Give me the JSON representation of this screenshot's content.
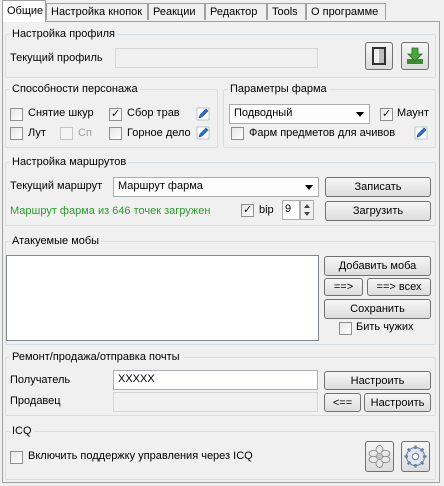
{
  "tabs": [
    "Общие",
    "Настройка кнопок",
    "Реакции",
    "Редактор",
    "Tools",
    "О программе"
  ],
  "profile": {
    "legend": "Настройка профиля",
    "label": "Текущий профиль",
    "value": "",
    "open_icon": "open-book-icon",
    "save_icon": "download-save-icon"
  },
  "abilities": {
    "legend": "Способности персонажа",
    "skinning": "Снятие шкур",
    "herbs": "Сбор трав",
    "loot": "Лут",
    "sp": "Сп",
    "mining": "Горное дело"
  },
  "farm": {
    "legend": "Параметры фарма",
    "mode": "Подводный",
    "mount": "Маунт",
    "achievements": "Фарм предметов для ачивов"
  },
  "routes": {
    "legend": "Настройка маршрутов",
    "label": "Текущий маршрут",
    "current": "Маршрут фарма",
    "record": "Записать",
    "status": "Маршрут фарма из 646 точек загружен",
    "bip": "bip",
    "bip_value": "9",
    "load": "Загрузить"
  },
  "mobs": {
    "legend": "Атакуемые мобы",
    "add": "Добавить моба",
    "move": "==>",
    "move_all": "==> всех",
    "save": "Сохранить",
    "beat_others": "Бить чужих"
  },
  "mail": {
    "legend": "Ремонт/продажа/отправка почты",
    "recipient_label": "Получатель",
    "recipient": "XXXXX",
    "configure": "Настроить",
    "seller_label": "Продавец",
    "seller": "",
    "back": "<==",
    "configure2": "Настроить"
  },
  "icq": {
    "legend": "ICQ",
    "enable": "Включить поддержку управления через ICQ",
    "flower_icon": "icq-flower-icon",
    "settings_icon": "gear-settings-icon"
  },
  "colors": {
    "accent_green": "#2aa02a",
    "pencil_blue": "#2b6fd6"
  }
}
